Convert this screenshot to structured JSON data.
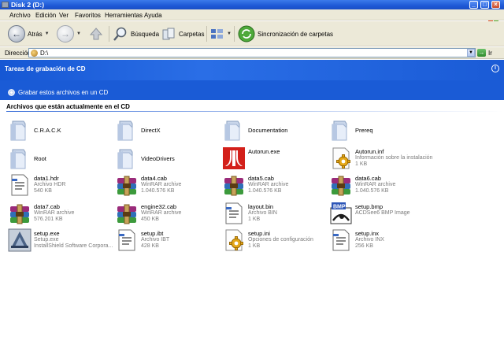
{
  "window": {
    "title": "Disk 2 (D:)"
  },
  "menu": [
    "Archivo",
    "Edición",
    "Ver",
    "Favoritos",
    "Herramientas",
    "Ayuda"
  ],
  "toolbar": {
    "back_label": "Atrás",
    "search_label": "Búsqueda",
    "folders_label": "Carpetas",
    "sync_label": "Sincronización de carpetas"
  },
  "address": {
    "label": "Dirección",
    "value": "D:\\",
    "go_label": "Ir"
  },
  "cd_tasks": {
    "title": "Tareas de grabación de CD",
    "task": "Grabar estos archivos en un CD"
  },
  "files_section": {
    "title": "Archivos que están actualmente en el CD"
  },
  "items": [
    {
      "name": "C.R.A.C.K",
      "type": "folder",
      "icon": "folder-icon"
    },
    {
      "name": "DirectX",
      "type": "folder",
      "icon": "folder-icon"
    },
    {
      "name": "Documentation",
      "type": "folder",
      "icon": "folder-icon"
    },
    {
      "name": "Prereq",
      "type": "folder",
      "icon": "folder-icon"
    },
    {
      "name": "Root",
      "type": "folder",
      "icon": "folder-icon"
    },
    {
      "name": "VideoDrivers",
      "type": "folder",
      "icon": "folder-icon"
    },
    {
      "name": "Autorun.exe",
      "type": "atari",
      "icon": "atari-icon"
    },
    {
      "name": "Autorun.inf",
      "line2": "Información sobre la instalación",
      "line3": "1 KB",
      "type": "inf",
      "icon": "config-file-icon"
    },
    {
      "name": "data1.hdr",
      "line2": "Archivo HDR",
      "line3": "540 KB",
      "type": "doc",
      "icon": "hdr-file-icon"
    },
    {
      "name": "data4.cab",
      "line2": "WinRAR archive",
      "line3": "1.040.576 KB",
      "type": "rar",
      "icon": "winrar-icon"
    },
    {
      "name": "data5.cab",
      "line2": "WinRAR archive",
      "line3": "1.040.576 KB",
      "type": "rar",
      "icon": "winrar-icon"
    },
    {
      "name": "data6.cab",
      "line2": "WinRAR archive",
      "line3": "1.040.576 KB",
      "type": "rar",
      "icon": "winrar-icon"
    },
    {
      "name": "data7.cab",
      "line2": "WinRAR archive",
      "line3": "576.201 KB",
      "type": "rar",
      "icon": "winrar-icon"
    },
    {
      "name": "engine32.cab",
      "line2": "WinRAR archive",
      "line3": "450 KB",
      "type": "rar",
      "icon": "winrar-icon"
    },
    {
      "name": "layout.bin",
      "line2": "Archivo BIN",
      "line3": "1 KB",
      "type": "doc",
      "icon": "bin-file-icon"
    },
    {
      "name": "setup.bmp",
      "line2": "ACDSee6 BMP Image",
      "line3": "",
      "type": "bmp",
      "icon": "bmp-image-icon"
    },
    {
      "name": "setup.exe",
      "line2": "Setup.exe",
      "line3": "InstallShield Software Corpora...",
      "type": "installshield",
      "icon": "installshield-icon"
    },
    {
      "name": "setup.ibt",
      "line2": "Archivo IBT",
      "line3": "428 KB",
      "type": "doc",
      "icon": "ibt-file-icon"
    },
    {
      "name": "setup.ini",
      "line2": "Opciones de configuración",
      "line3": "1 KB",
      "type": "inf",
      "icon": "settings-file-icon"
    },
    {
      "name": "setup.inx",
      "line2": "Archivo INX",
      "line3": "256 KB",
      "type": "doc",
      "icon": "inx-file-icon"
    }
  ]
}
